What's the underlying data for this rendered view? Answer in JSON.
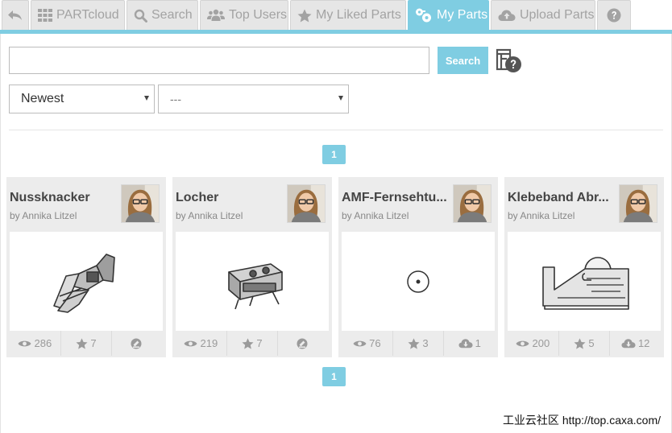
{
  "tabs": [
    {
      "label": "",
      "icon": "back-icon"
    },
    {
      "label": "PARTcloud",
      "icon": "grid-icon"
    },
    {
      "label": "Search",
      "icon": "search-icon"
    },
    {
      "label": "Top Users",
      "icon": "users-icon"
    },
    {
      "label": "My Liked Parts",
      "icon": "star-icon"
    },
    {
      "label": "My Parts",
      "icon": "my-parts-icon",
      "active": true
    },
    {
      "label": "Upload Parts",
      "icon": "cloud-upload-icon"
    },
    {
      "label": "",
      "icon": "help-icon"
    }
  ],
  "search": {
    "value": "",
    "placeholder": "",
    "button_label": "Search"
  },
  "sort_select": {
    "selected": "Newest"
  },
  "filter_select": {
    "selected": "---"
  },
  "pagination": {
    "current": "1"
  },
  "parts": [
    {
      "title": "Nussknacker",
      "author": "by Annika Litzel",
      "views": "286",
      "likes": "7",
      "third_icon": "stamp-icon",
      "third_value": "",
      "preview": "nutcracker-model"
    },
    {
      "title": "Locher",
      "author": "by Annika Litzel",
      "views": "219",
      "likes": "7",
      "third_icon": "stamp-icon",
      "third_value": "",
      "preview": "hole-punch-model"
    },
    {
      "title": "AMF-Fernsehtu...",
      "author": "by Annika Litzel",
      "views": "76",
      "likes": "3",
      "third_icon": "cloud-download-icon",
      "third_value": "1",
      "preview": "small-circle-model"
    },
    {
      "title": "Klebeband Abr...",
      "author": "by Annika Litzel",
      "views": "200",
      "likes": "5",
      "third_icon": "cloud-download-icon",
      "third_value": "12",
      "preview": "tape-dispenser-model"
    }
  ],
  "watermark": "工业云社区 http://top.caxa.com/",
  "colors": {
    "accent": "#7fcde2",
    "tab_inactive": "#e6e6e6",
    "card_bg": "#ececec"
  }
}
